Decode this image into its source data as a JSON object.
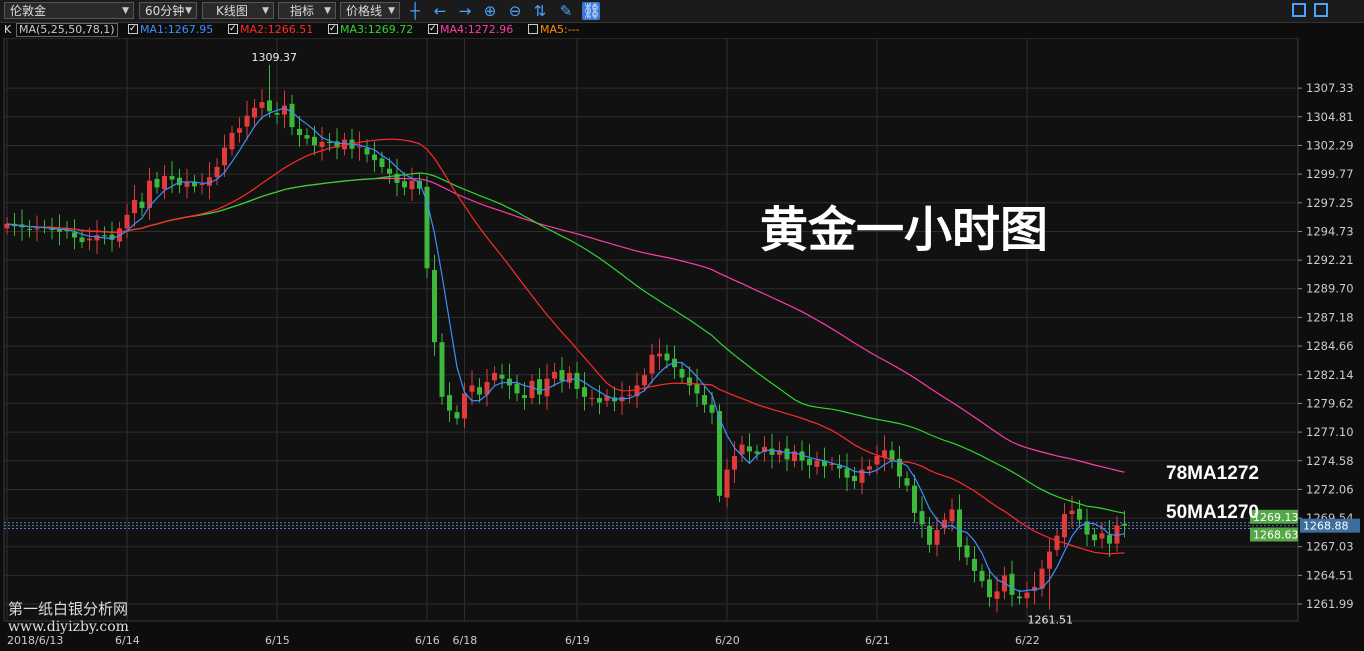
{
  "toolbar": {
    "instrument": "伦敦金",
    "period": "60分钟",
    "chart_type": "K线图",
    "indicator": "指标",
    "price_line": "价格线",
    "icons": [
      "crosshair-icon",
      "arrow-left-icon",
      "arrow-right-icon",
      "zoom-in-icon",
      "zoom-out-icon",
      "axis-icon",
      "pen-icon",
      "link-icon"
    ],
    "window_icons": [
      "layout-icon",
      "page-icon"
    ]
  },
  "legend": {
    "k": "K",
    "ma_params": "MA(5,25,50,78,1)",
    "ma1": "MA1:1267.95",
    "ma2": "MA2:1266.51",
    "ma3": "MA3:1269.72",
    "ma4": "MA4:1272.96",
    "ma5": "MA5:---"
  },
  "overlay": {
    "title": "黄金一小时图",
    "label78": "78MA1272",
    "label50": "50MA1270",
    "watermark1": "第一纸白银分析网",
    "watermark2": "www.diyizby.com"
  },
  "colors": {
    "up": "#e23a3a",
    "down": "#3cb83c",
    "ma1": "#3a8fff",
    "ma2": "#ff2a2a",
    "ma3": "#2fd62f",
    "ma4": "#ff3ca8",
    "ma5": "#ff8c00",
    "grid": "#2e2e2e",
    "dotted": "#5a7ccf",
    "badge": "#55a846"
  },
  "chart_data": {
    "type": "candlestick",
    "ylim": [
      1260.5,
      1309.8
    ],
    "yticks": [
      "1307.33",
      "1304.81",
      "1302.29",
      "1299.77",
      "1297.25",
      "1294.73",
      "1292.21",
      "1289.70",
      "1287.18",
      "1284.66",
      "1282.14",
      "1279.62",
      "1277.10",
      "1274.58",
      "1272.06",
      "1269.54",
      "1267.03",
      "1264.51",
      "1261.99"
    ],
    "xticks": [
      {
        "label": "2018/6/13",
        "i": 0
      },
      {
        "label": "6/14",
        "i": 16
      },
      {
        "label": "6/15",
        "i": 36
      },
      {
        "label": "6/16",
        "i": 56
      },
      {
        "label": "6/18",
        "i": 61
      },
      {
        "label": "6/19",
        "i": 76
      },
      {
        "label": "6/20",
        "i": 96
      },
      {
        "label": "6/21",
        "i": 116
      },
      {
        "label": "6/22",
        "i": 136
      }
    ],
    "high_label": "1309.37",
    "low_label": "1261.51",
    "price_badges": [
      {
        "label": "1269.13",
        "value": 1269.13
      },
      {
        "label": "1268.88",
        "value": 1268.88
      },
      {
        "label": "1268.63",
        "value": 1268.63
      }
    ],
    "closes": [
      1295.4,
      1295.2,
      1295.1,
      1294.9,
      1295.0,
      1295.1,
      1294.9,
      1294.7,
      1294.8,
      1294.2,
      1293.8,
      1294.1,
      1294.4,
      1294.3,
      1294.0,
      1295.0,
      1296.2,
      1297.5,
      1296.8,
      1299.2,
      1298.6,
      1299.6,
      1299.3,
      1298.8,
      1299.1,
      1298.7,
      1298.9,
      1299.5,
      1300.4,
      1302.1,
      1303.4,
      1303.8,
      1304.9,
      1305.6,
      1306.1,
      1305.3,
      1305.0,
      1305.8,
      1303.9,
      1303.2,
      1302.9,
      1302.3,
      1302.6,
      1302.5,
      1302.1,
      1302.8,
      1302.0,
      1302.2,
      1301.5,
      1301.0,
      1300.4,
      1299.8,
      1299.0,
      1298.6,
      1299.2,
      1298.5,
      1291.5,
      1285.0,
      1280.2,
      1279.0,
      1278.3,
      1280.5,
      1281.2,
      1280.4,
      1281.5,
      1282.3,
      1281.8,
      1281.2,
      1280.5,
      1280.1,
      1281.6,
      1280.4,
      1281.8,
      1282.4,
      1281.6,
      1282.3,
      1280.9,
      1280.2,
      1280.1,
      1279.7,
      1280.3,
      1279.8,
      1280.2,
      1280.4,
      1281.2,
      1282.1,
      1283.9,
      1284.0,
      1283.4,
      1282.8,
      1281.9,
      1281.2,
      1280.5,
      1279.5,
      1278.8,
      1271.5,
      1273.8,
      1275.0,
      1276.0,
      1275.4,
      1275.2,
      1275.8,
      1275.1,
      1275.5,
      1274.7,
      1275.4,
      1274.6,
      1274.2,
      1274.6,
      1274.1,
      1274.3,
      1273.9,
      1273.1,
      1272.8,
      1273.8,
      1274.1,
      1275.0,
      1275.5,
      1274.6,
      1273.2,
      1272.4,
      1270.0,
      1269.0,
      1267.2,
      1268.5,
      1269.4,
      1270.3,
      1267.0,
      1266.1,
      1264.9,
      1264.0,
      1262.6,
      1263.1,
      1264.5,
      1262.8,
      1262.5,
      1263.0,
      1263.5,
      1265.1,
      1266.6,
      1268.0,
      1269.9,
      1270.2,
      1269.4,
      1268.1,
      1267.6,
      1268.2,
      1267.3,
      1268.9,
      1268.88
    ]
  }
}
